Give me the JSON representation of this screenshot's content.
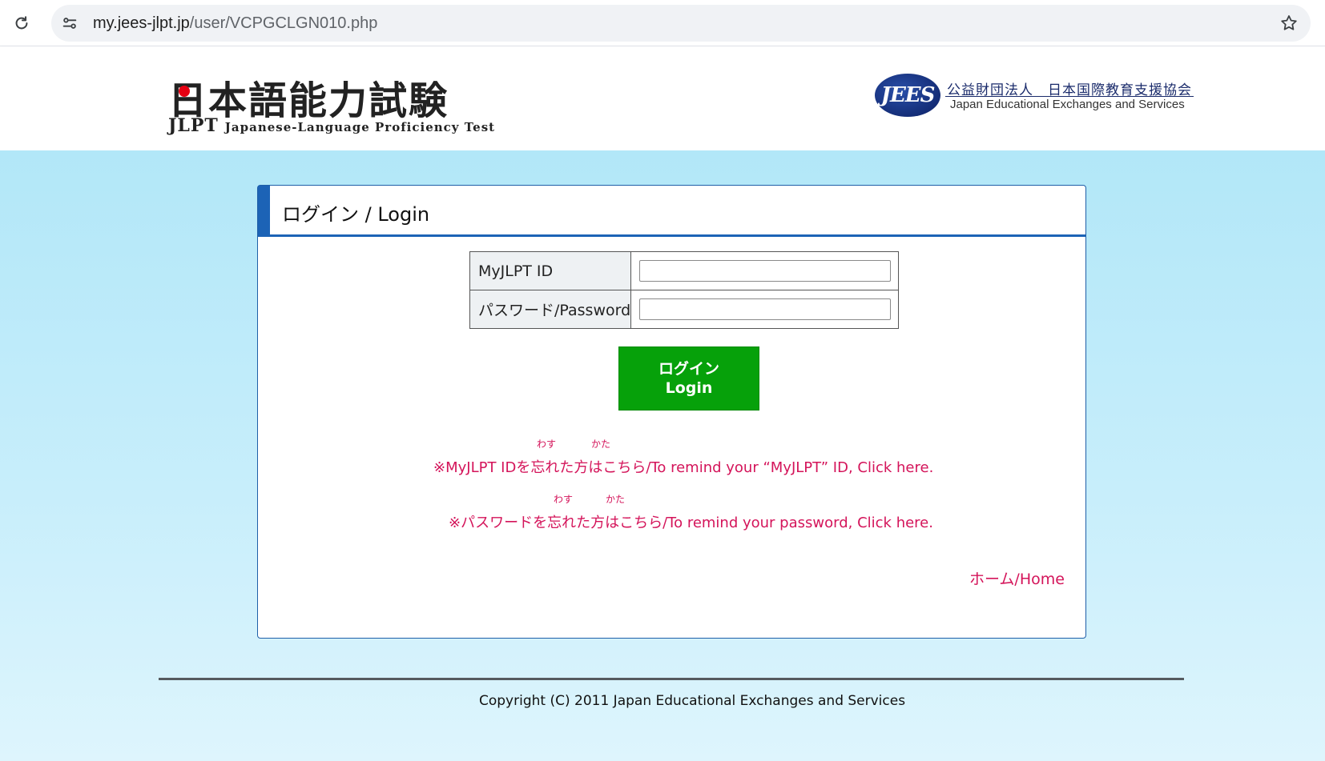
{
  "browser": {
    "url_host": "my.jees-jlpt.jp",
    "url_path": "/user/VCPGCLGN010.php"
  },
  "header": {
    "jlpt_title": "日本語能力試験",
    "jlpt_abbr": "JLPT",
    "jlpt_english": "Japanese-Language Proficiency Test",
    "jees_emblem": "JEES",
    "jees_japanese": "公益財団法人　日本国際教育支援協会",
    "jees_english": "Japan Educational Exchanges and Services"
  },
  "login": {
    "title": "ログイン / Login",
    "id_label": "MyJLPT ID",
    "id_value": "",
    "password_label": "パスワード/Password",
    "password_value": "",
    "button_line1": "ログイン",
    "button_line2": "Login"
  },
  "links": {
    "remind_id": "※MyJLPT IDを忘れた方はこちら/To remind your “MyJLPT” ID, Click here.",
    "remind_password": "※パスワードを忘れた方はこちら/To remind your password, Click here.",
    "ruby_wasu": "わす",
    "ruby_kata": "かた",
    "home": "ホーム/Home"
  },
  "footer": {
    "copyright": "Copyright (C) 2011 Japan Educational Exchanges and Services"
  },
  "colors": {
    "accent_blue": "#1c63b6",
    "login_green": "#06a10a",
    "link_pink": "#d4145a",
    "background_light_blue": "#b2e7f8"
  },
  "icons": {
    "reload": "reload-icon",
    "site_info": "site-info-icon",
    "bookmark": "star-icon"
  }
}
